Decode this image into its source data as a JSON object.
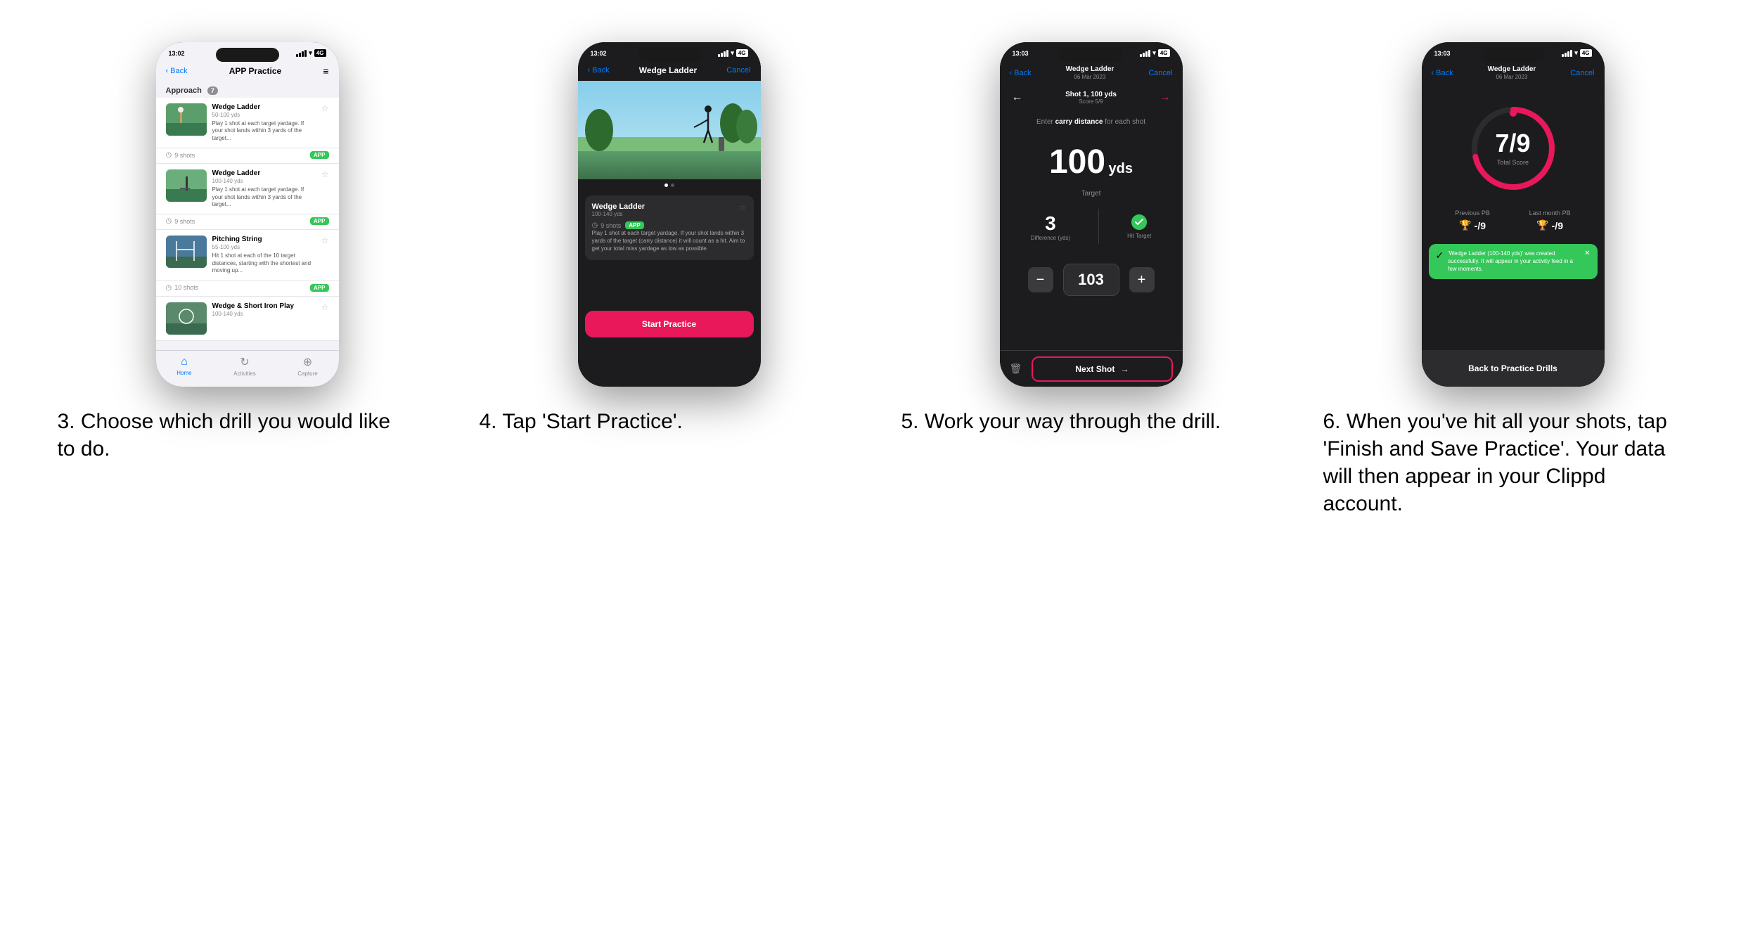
{
  "page": {
    "background": "#ffffff"
  },
  "steps": [
    {
      "id": "step3",
      "number": "3.",
      "description": "Choose which drill you would like to do.",
      "phone": {
        "time": "13:02",
        "nav": {
          "back": "Back",
          "title": "APP Practice",
          "menu": "≡"
        },
        "section": {
          "label": "Approach",
          "count": "7"
        },
        "drills": [
          {
            "name": "Wedge Ladder",
            "range": "50-100 yds",
            "desc": "Play 1 shot at each target yardage. If your shot lands within 3 yards of the target...",
            "shots": "9 shots",
            "badge": "APP"
          },
          {
            "name": "Wedge Ladder",
            "range": "100-140 yds",
            "desc": "Play 1 shot at each target yardage. If your shot lands within 3 yards of the target...",
            "shots": "9 shots",
            "badge": "APP"
          },
          {
            "name": "Pitching String",
            "range": "55-100 yds",
            "desc": "Hit 1 shot at each of the 10 target distances, starting with the shortest and moving up...",
            "shots": "10 shots",
            "badge": "APP"
          },
          {
            "name": "Wedge & Short Iron Play",
            "range": "100-140 yds",
            "desc": "",
            "shots": "",
            "badge": ""
          }
        ],
        "tabs": [
          {
            "label": "Home",
            "icon": "⌂",
            "active": true
          },
          {
            "label": "Activities",
            "icon": "♻",
            "active": false
          },
          {
            "label": "Capture",
            "icon": "+",
            "active": false
          }
        ]
      }
    },
    {
      "id": "step4",
      "number": "4.",
      "description": "Tap 'Start Practice'.",
      "phone": {
        "time": "13:02",
        "nav": {
          "back": "Back",
          "title": "Wedge Ladder",
          "cancel": "Cancel"
        },
        "card": {
          "name": "Wedge Ladder",
          "range": "100-140 yds",
          "shots": "9 shots",
          "badge": "APP",
          "desc": "Play 1 shot at each target yardage. If your shot lands within 3 yards of the target (carry distance) it will count as a hit. Aim to get your total miss yardage as low as possible."
        },
        "startButton": "Start Practice"
      }
    },
    {
      "id": "step5",
      "number": "5.",
      "description": "Work your way through the drill.",
      "phone": {
        "time": "13:03",
        "nav": {
          "back": "Back",
          "title": "Wedge Ladder",
          "subtitle": "06 Mar 2023",
          "cancel": "Cancel"
        },
        "shot": {
          "label": "Shot 1, 100 yds",
          "score": "Score 5/9"
        },
        "instruction": "Enter carry distance for each shot",
        "target": {
          "value": "100",
          "unit": "yds",
          "label": "Target"
        },
        "stats": {
          "difference": "3",
          "differenceLabel": "Difference (yds)",
          "hitTarget": "Hit Target"
        },
        "counter": {
          "value": "103",
          "minus": "−",
          "plus": "+"
        },
        "nextShot": "Next Shot"
      }
    },
    {
      "id": "step6",
      "number": "6.",
      "description": "When you've hit all your shots, tap 'Finish and Save Practice'. Your data will then appear in your Clippd account.",
      "phone": {
        "time": "13:03",
        "nav": {
          "back": "Back",
          "title": "Wedge Ladder",
          "subtitle": "06 Mar 2023",
          "cancel": "Cancel"
        },
        "score": {
          "value": "7",
          "outOf": "9",
          "label": "Total Score"
        },
        "pb": {
          "previous": {
            "label": "Previous PB",
            "value": "-/9"
          },
          "lastMonth": {
            "label": "Last month PB",
            "value": "-/9"
          }
        },
        "toast": {
          "text": "'Wedge Ladder (100-140 yds)' was created successfully. It will appear in your activity feed in a few moments."
        },
        "backButton": "Back to Practice Drills"
      }
    }
  ]
}
